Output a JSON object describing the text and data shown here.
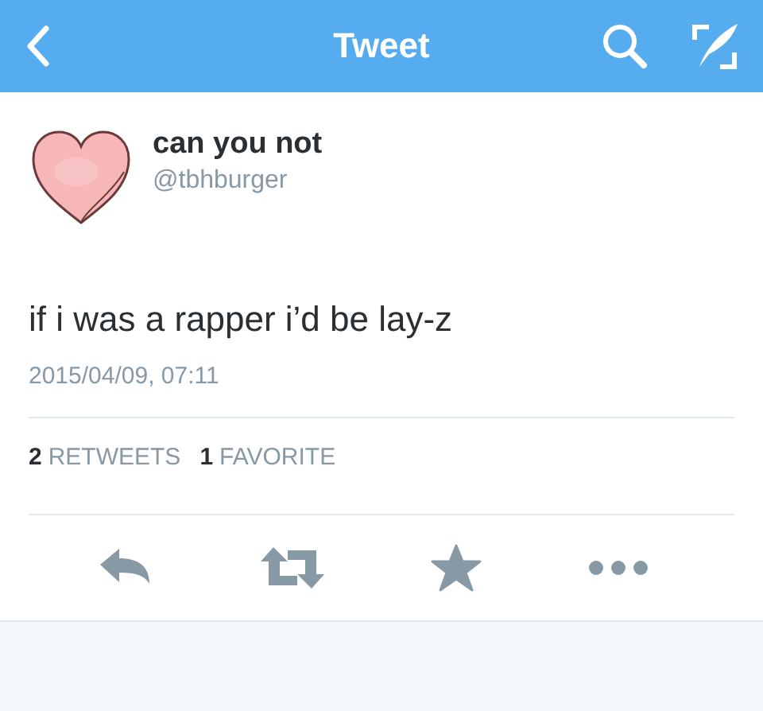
{
  "header": {
    "title": "Tweet"
  },
  "author": {
    "name": "can you not",
    "handle": "@tbhburger"
  },
  "tweet": {
    "text": "if i was a rapper i’d be lay-z",
    "timestamp": "2015/04/09, 07:11"
  },
  "stats": [
    {
      "count": "2",
      "label": "RETWEETS"
    },
    {
      "count": "1",
      "label": "FAVORITE"
    }
  ],
  "actions": [
    {
      "kind": "reply"
    },
    {
      "kind": "retweet"
    },
    {
      "kind": "favorite"
    },
    {
      "kind": "more"
    }
  ]
}
